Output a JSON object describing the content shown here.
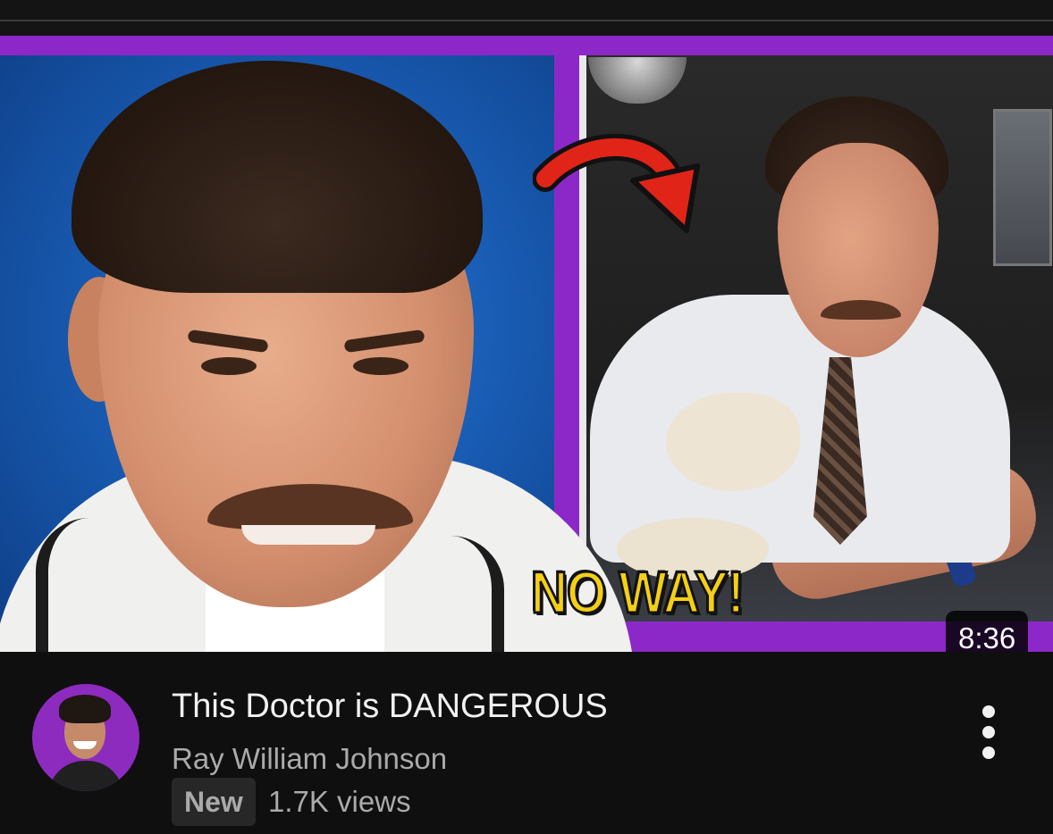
{
  "video": {
    "title": "This Doctor is DANGEROUS",
    "channel": "Ray William Johnson",
    "badge": "New",
    "views": "1.7K views",
    "duration": "8:36"
  },
  "thumbnail": {
    "overlay_text": "NO WAY!",
    "border_color": "#8c28c8",
    "arrow_color": "#e02418"
  },
  "actions": {
    "more_icon": "more-vert-icon"
  },
  "colors": {
    "background": "#0f0f0f",
    "title_text": "#f1f1f1",
    "secondary_text": "#aaaaaa",
    "avatar_ring": "#8e2bbf",
    "noway_text": "#f4cf16"
  }
}
